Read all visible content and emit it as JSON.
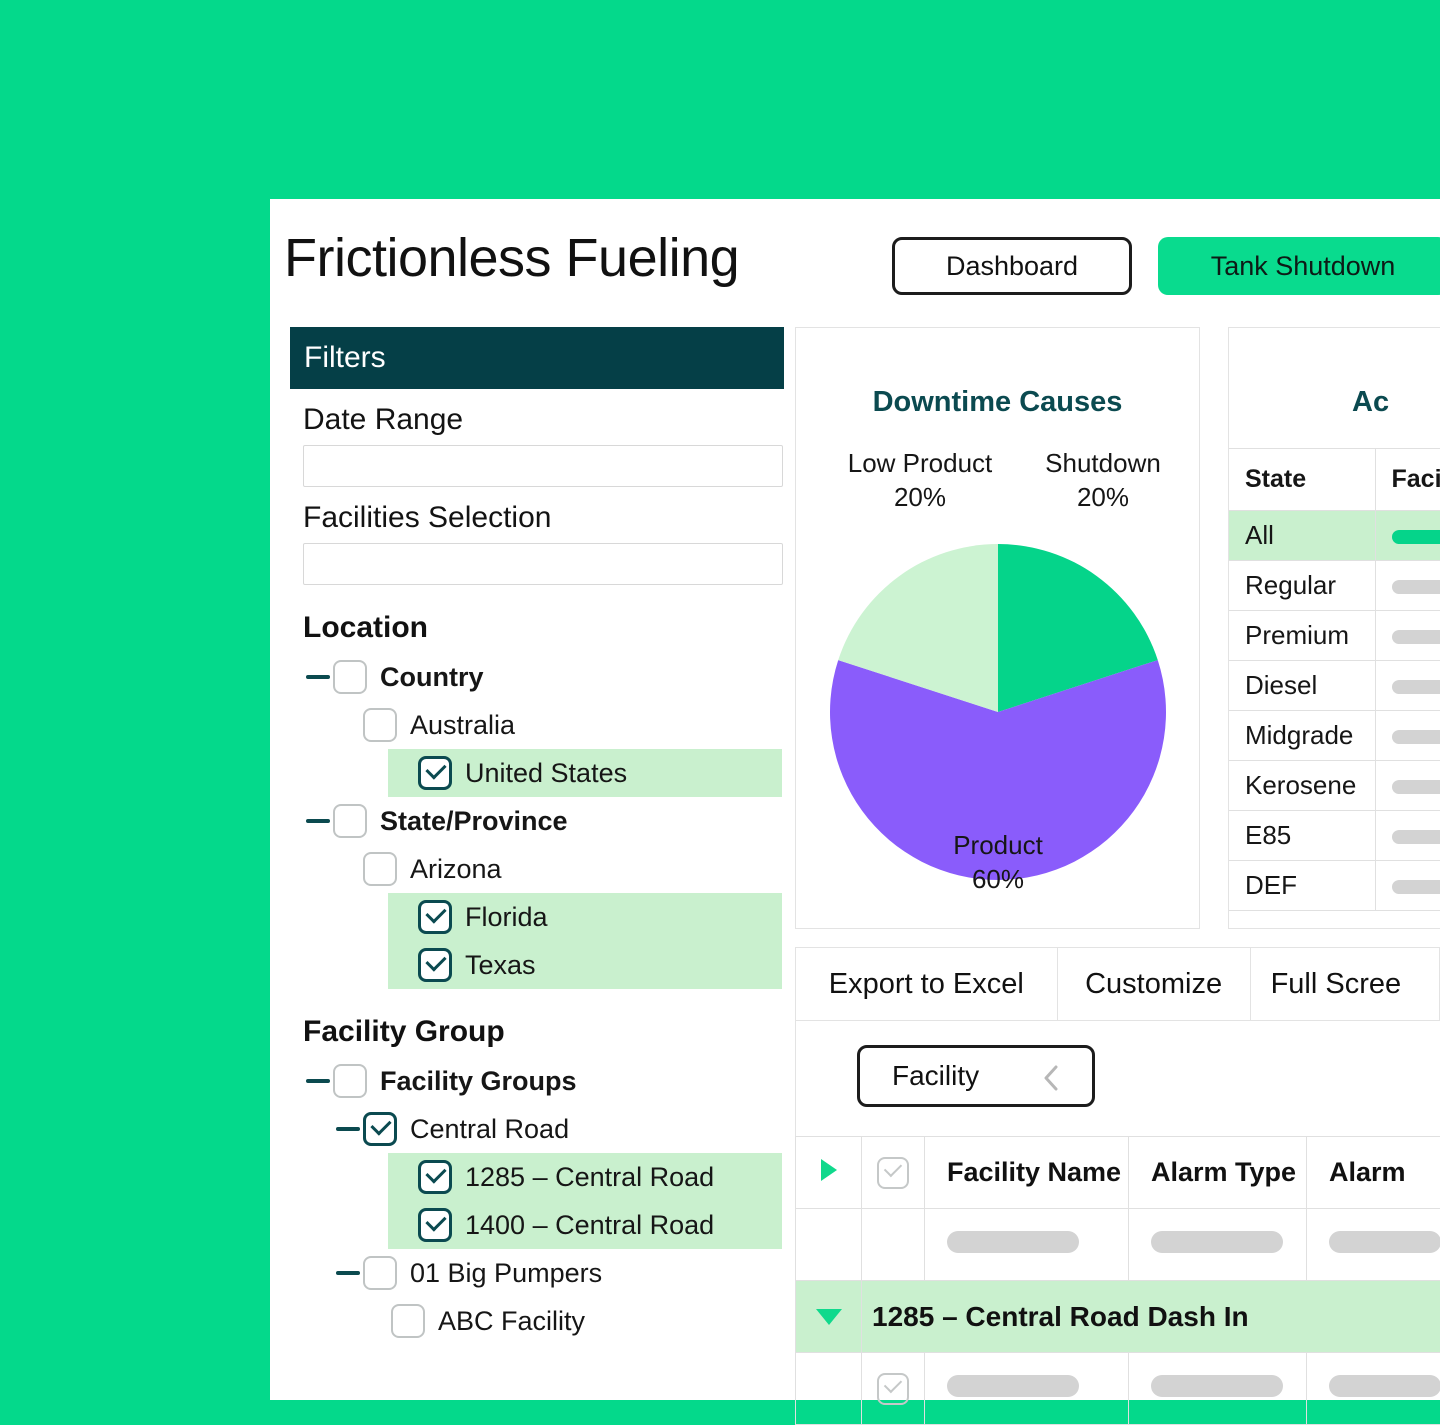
{
  "header": {
    "title": "Frictionless Fueling",
    "dashboard_label": "Dashboard",
    "tank_shutdown_label": "Tank Shutdown"
  },
  "filters": {
    "title": "Filters",
    "date_range_label": "Date Range",
    "date_range_value": "",
    "date_range_placeholder": "",
    "facilities_selection_label": "Facilities Selection",
    "facilities_selection_value": "",
    "facilities_selection_placeholder": "",
    "location_heading": "Location",
    "facility_group_heading": "Facility Group",
    "location_tree": [
      {
        "label": "Country",
        "depth": 0,
        "bold": true,
        "checked": false,
        "selected": false,
        "toggle": "minus"
      },
      {
        "label": "Australia",
        "depth": 1,
        "bold": false,
        "checked": false,
        "selected": false,
        "toggle": "none"
      },
      {
        "label": "United States",
        "depth": 1,
        "bold": false,
        "checked": true,
        "selected": true,
        "toggle": "none"
      },
      {
        "label": "State/Province",
        "depth": 0,
        "bold": true,
        "checked": false,
        "selected": false,
        "toggle": "minus"
      },
      {
        "label": "Arizona",
        "depth": 1,
        "bold": false,
        "checked": false,
        "selected": false,
        "toggle": "none"
      },
      {
        "label": "Florida",
        "depth": 1,
        "bold": false,
        "checked": true,
        "selected": true,
        "toggle": "none"
      },
      {
        "label": "Texas",
        "depth": 1,
        "bold": false,
        "checked": true,
        "selected": true,
        "toggle": "none"
      }
    ],
    "facility_tree": [
      {
        "label": "Facility Groups",
        "depth": 0,
        "bold": true,
        "checked": false,
        "selected": false,
        "toggle": "minus"
      },
      {
        "label": "Central Road",
        "depth": 1,
        "bold": false,
        "checked": true,
        "selected": false,
        "toggle": "minus"
      },
      {
        "label": "1285 – Central Road",
        "depth": 2,
        "bold": false,
        "checked": true,
        "selected": true,
        "toggle": "none"
      },
      {
        "label": "1400 – Central Road",
        "depth": 2,
        "bold": false,
        "checked": true,
        "selected": true,
        "toggle": "none"
      },
      {
        "label": "01 Big Pumpers",
        "depth": 1,
        "bold": false,
        "checked": false,
        "selected": false,
        "toggle": "minus"
      },
      {
        "label": "ABC Facility",
        "depth": 2,
        "bold": false,
        "checked": false,
        "selected": false,
        "toggle": "none"
      }
    ]
  },
  "chart_data": {
    "type": "pie",
    "title": "Downtime Causes",
    "categories": [
      "Shutdown",
      "Product",
      "Low Product"
    ],
    "values": [
      20,
      60,
      20
    ],
    "unit": "%",
    "colors": [
      "#05D48A",
      "#8A5CFB",
      "#CCF3D2"
    ],
    "labels": [
      {
        "name": "Low Product",
        "value": "20%"
      },
      {
        "name": "Shutdown",
        "value": "20%"
      },
      {
        "name": "Product",
        "value": "60%"
      }
    ],
    "legend": "none",
    "grid": false
  },
  "state_card": {
    "title": "Ac",
    "columns": [
      "State",
      "Facili"
    ],
    "rows": [
      {
        "state": "All",
        "selected": true,
        "bar_on": true
      },
      {
        "state": "Regular",
        "selected": false,
        "bar_on": false
      },
      {
        "state": "Premium",
        "selected": false,
        "bar_on": false
      },
      {
        "state": "Diesel",
        "selected": false,
        "bar_on": false
      },
      {
        "state": "Midgrade",
        "selected": false,
        "bar_on": false
      },
      {
        "state": "Kerosene",
        "selected": false,
        "bar_on": false
      },
      {
        "state": "E85",
        "selected": false,
        "bar_on": false
      },
      {
        "state": "DEF",
        "selected": false,
        "bar_on": false
      }
    ]
  },
  "toolbar": {
    "export_label": "Export to Excel",
    "customize_label": "Customize",
    "full_screen_label": "Full Scree"
  },
  "facility_selector": {
    "label": "Facility"
  },
  "alarm_table": {
    "columns": [
      "Facility Name",
      "Alarm Type",
      "Alarm"
    ],
    "group_row_label": "1285 – Central Road Dash In"
  }
}
